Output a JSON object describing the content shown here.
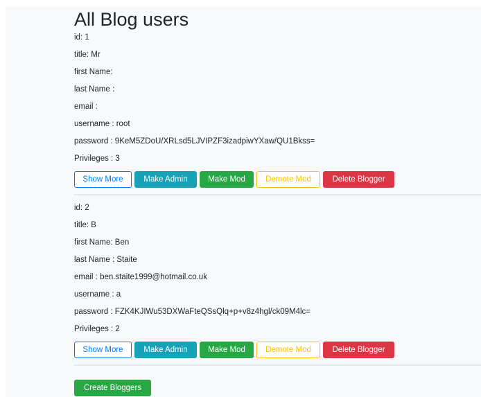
{
  "page": {
    "title": "All Blog users"
  },
  "users": [
    {
      "id": "id: 1",
      "title": "title: Mr",
      "first_name": "first Name:",
      "last_name": "last Name :",
      "email": "email :",
      "username": "username : root",
      "password": "password : 9KeM5ZDoU/XRLsd5LJVIPZF3izadpiwYXaw/QU1Bkss=",
      "privileges": "Privileges : 3"
    },
    {
      "id": "id: 2",
      "title": "title: B",
      "first_name": "first Name: Ben",
      "last_name": "last Name : Staite",
      "email": "email : ben.staite1999@hotmail.co.uk",
      "username": "username : a",
      "password": "password : FZK4KJIWu53DXWaFteQSsQlq+p+v8z4hgl/ck09M4lc=",
      "privileges": "Privileges : 2"
    }
  ],
  "actions": {
    "show_more": "Show More",
    "make_admin": "Make Admin",
    "make_mod": "Make Mod",
    "demote_mod": "Demote Mod",
    "delete_blogger": "Delete Blogger"
  },
  "footer": {
    "create_bloggers": "Create Bloggers"
  },
  "colors": {
    "primary": "#007bff",
    "info": "#17a2b8",
    "success": "#28a745",
    "warning": "#ffc107",
    "danger": "#dc3545",
    "background": "#f8f9fa"
  }
}
